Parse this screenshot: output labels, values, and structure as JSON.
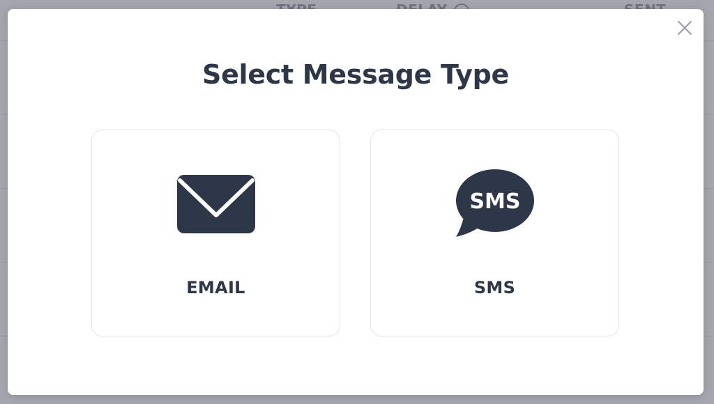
{
  "background": {
    "columns": {
      "type": "TYPE",
      "delay": "DELAY",
      "sent": "SENT"
    }
  },
  "modal": {
    "title": "Select Message Type",
    "close_icon": "close-icon",
    "options": [
      {
        "label": "EMAIL",
        "icon": "envelope-icon"
      },
      {
        "label": "SMS",
        "icon": "sms-bubble-icon",
        "icon_text": "SMS"
      }
    ]
  },
  "colors": {
    "text_dark": "#2d3748",
    "card_border": "#e1e3e6",
    "overlay": "#a3a6ad",
    "close_icon": "#9aa0a6"
  }
}
